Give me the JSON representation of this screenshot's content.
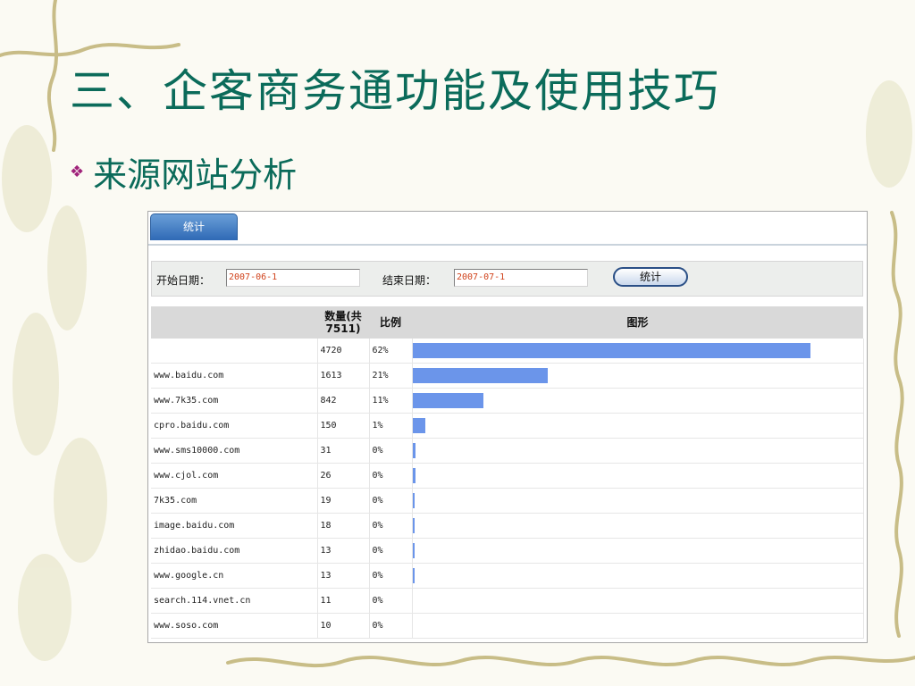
{
  "slide": {
    "title": "三、企客商务通功能及使用技巧",
    "bullet": "来源网站分析"
  },
  "panel": {
    "tab_label": "统计",
    "start_label": "开始日期：",
    "start_value": "2007-06-1",
    "end_label": "结束日期：",
    "end_value": "2007-07-1",
    "submit_label": "统计"
  },
  "table": {
    "headers": {
      "source": "",
      "count": "数量(共7511)",
      "ratio": "比例",
      "chart": "图形"
    },
    "rows": [
      {
        "source": "",
        "count": "4720",
        "ratio": "62%",
        "fraction": 0.62
      },
      {
        "source": "www.baidu.com",
        "count": "1613",
        "ratio": "21%",
        "fraction": 0.21
      },
      {
        "source": "www.7k35.com",
        "count": "842",
        "ratio": "11%",
        "fraction": 0.11
      },
      {
        "source": "cpro.baidu.com",
        "count": "150",
        "ratio": "1%",
        "fraction": 0.02
      },
      {
        "source": "www.sms10000.com",
        "count": "31",
        "ratio": "0%",
        "fraction": 0.004
      },
      {
        "source": "www.cjol.com",
        "count": "26",
        "ratio": "0%",
        "fraction": 0.0035
      },
      {
        "source": "7k35.com",
        "count": "19",
        "ratio": "0%",
        "fraction": 0.0025
      },
      {
        "source": "image.baidu.com",
        "count": "18",
        "ratio": "0%",
        "fraction": 0.0024
      },
      {
        "source": "zhidao.baidu.com",
        "count": "13",
        "ratio": "0%",
        "fraction": 0.0017
      },
      {
        "source": "www.google.cn",
        "count": "13",
        "ratio": "0%",
        "fraction": 0.0017
      },
      {
        "source": "search.114.vnet.cn",
        "count": "11",
        "ratio": "0%",
        "fraction": 0
      },
      {
        "source": "www.soso.com",
        "count": "10",
        "ratio": "0%",
        "fraction": 0
      }
    ]
  },
  "colors": {
    "title": "#0b6b5a",
    "bullet": "#a0227a",
    "bar": "#6b95ea",
    "tab": "#2f69b5"
  }
}
